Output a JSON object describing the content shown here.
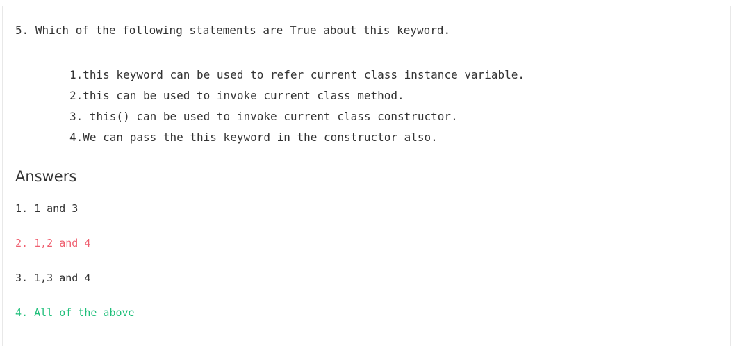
{
  "question": {
    "text": "5. Which of the following statements are True about this keyword."
  },
  "statements": [
    "1.this keyword can be used to refer current class instance variable.",
    "2.this can be used to invoke current class method.",
    "3. this() can be used to invoke current class constructor.",
    "4.We can pass the this keyword in the constructor also."
  ],
  "answers": {
    "heading": "Answers",
    "options": [
      {
        "label": "1. 1 and 3",
        "state": "neutral"
      },
      {
        "label": "2. 1,2 and 4",
        "state": "wrong"
      },
      {
        "label": "3. 1,3 and 4",
        "state": "neutral"
      },
      {
        "label": "4. All of the above",
        "state": "correct"
      }
    ]
  },
  "colors": {
    "text": "#333333",
    "wrong": "#ef5f6f",
    "correct": "#1fbf7a",
    "border": "#e8e8e8"
  }
}
